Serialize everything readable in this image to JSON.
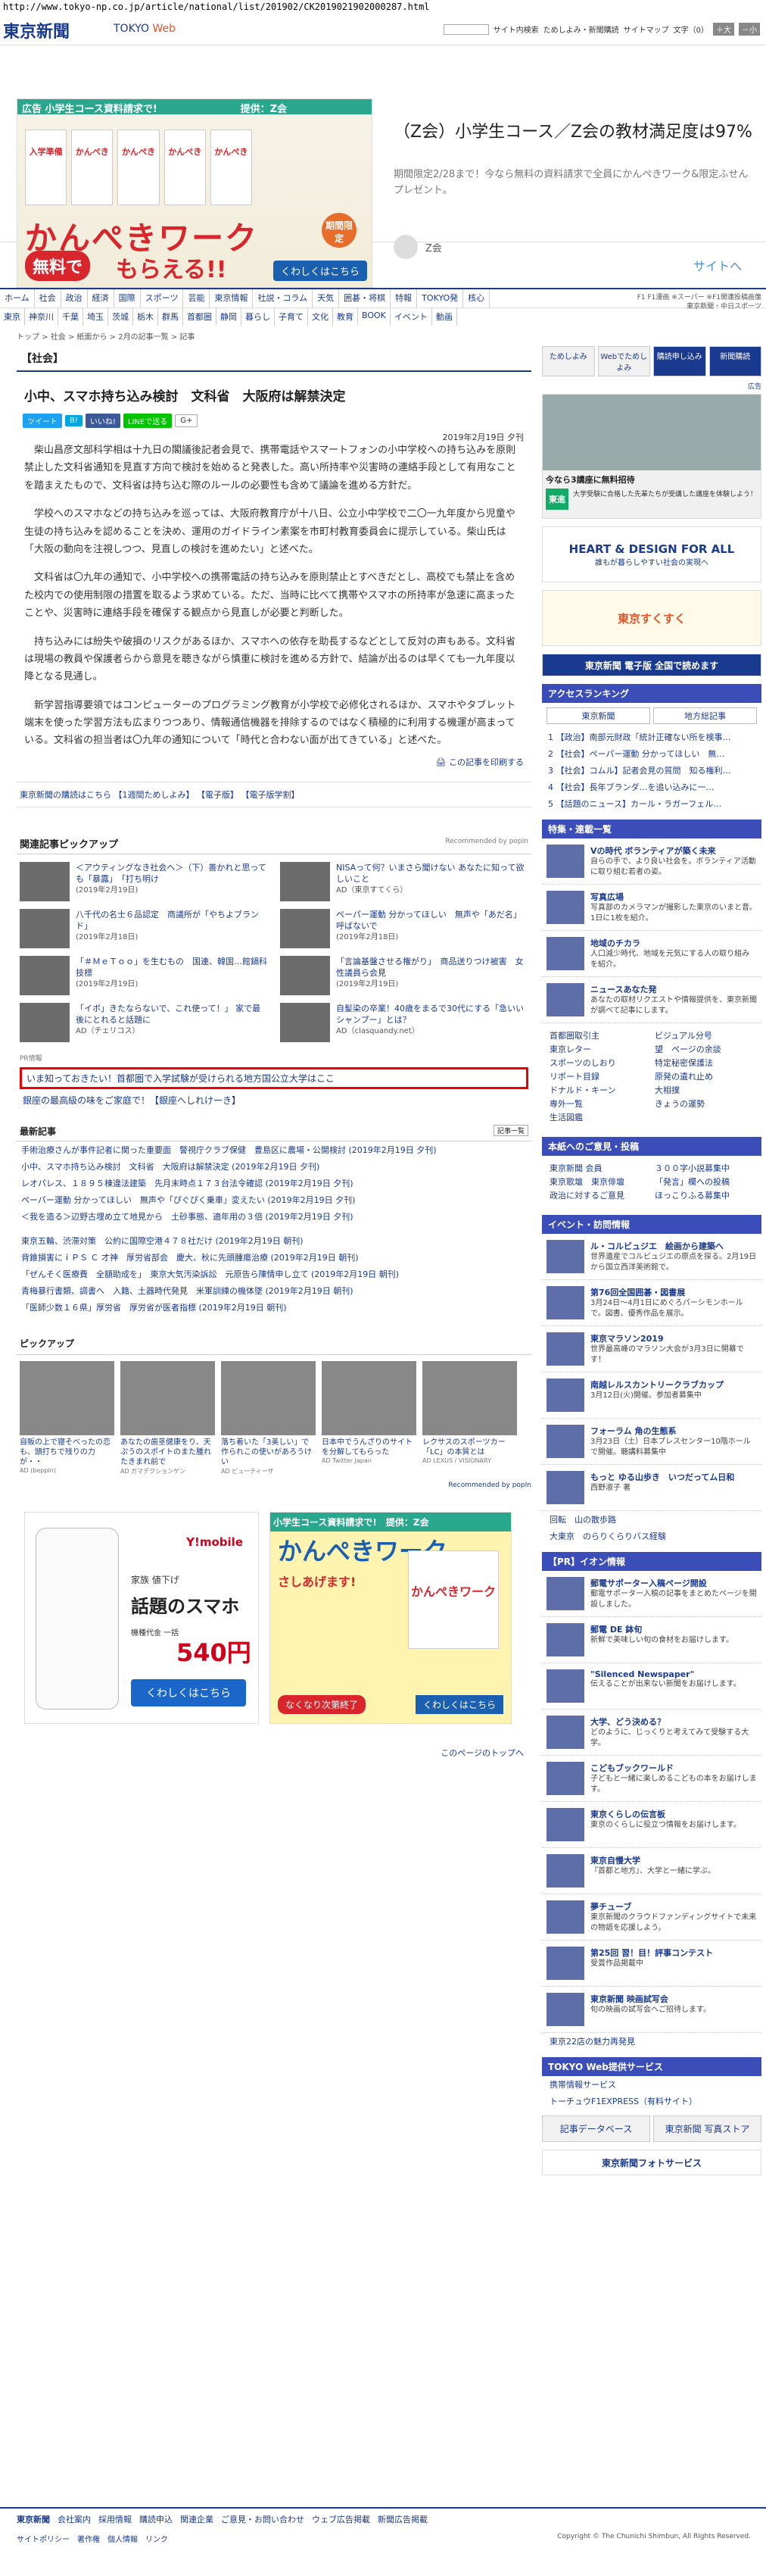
{
  "url": "http://www.tokyo-np.co.jp/article/national/list/201902/CK2019021902000287.html",
  "header": {
    "logo": "東京新聞",
    "sub_a": "TOKYO ",
    "sub_b": "Web",
    "links": [
      "サイト内検索",
      "ためしよみ・新聞購読",
      "サイトマップ",
      "文字（0）"
    ],
    "size_btns": [
      "＋大",
      "－小"
    ]
  },
  "top_ad": {
    "label": "広告",
    "bar": "小学生コース資料請求で!",
    "provider": "提供：Z会",
    "books": [
      "入学準備",
      "かんぺき",
      "かんぺき",
      "かんぺき",
      "かんぺき"
    ],
    "big": "かんぺきワーク",
    "free": "無料で",
    "morau": "もらえる!!",
    "limit": "期間限定",
    "more": "くわしくはこちら",
    "title": "（Z会）小学生コース／Z会の教材満足度は97%",
    "desc": "期間限定2/28まで！今なら無料の資料請求で全員にかんぺきワーク&限定ふせんプレゼント。",
    "advertiser": "Z会",
    "site": "サイトへ"
  },
  "nav": {
    "row1": [
      "ホーム",
      "社会",
      "政治",
      "経済",
      "国際",
      "スポーツ",
      "芸能",
      "東京情報",
      "社説・コラム",
      "天気",
      "囲碁・将棋",
      "特報",
      "TOKYO発",
      "核心"
    ],
    "row2": [
      "東京",
      "神奈川",
      "千葉",
      "埼玉",
      "茨城",
      "栃木",
      "群馬",
      "首都圏",
      "静岡",
      "暮らし",
      "子育て",
      "文化",
      "教育",
      "BOOK",
      "イベント",
      "動画"
    ],
    "right": [
      "F1 F1漫画 ※スーパー ※F1関連投稿画像",
      "東京新聞・中日スポーツ"
    ]
  },
  "breadcrumb": "トップ > 社会 > 紙面から > 2月の記事一覧 > 記事",
  "article": {
    "section": "【社会】",
    "title": "小中、スマホ持ち込み検討　文科省　大阪府は解禁決定",
    "share": [
      "ツイート",
      "B!",
      "いいね!",
      "LINEで送る",
      "G+"
    ],
    "date": "2019年2月19日 夕刊",
    "paragraphs": [
      "柴山昌彦文部科学相は十九日の閣議後記者会見で、携帯電話やスマートフォンの小中学校への持ち込みを原則禁止した文科省通知を見直す方向で検討を始めると発表した。高い所持率や災害時の連絡手段として有用なことを踏まえたもので、文科省は持ち込む際のルールの必要性も含めて議論を進める方針だ。",
      "学校へのスマホなどの持ち込みを巡っては、大阪府教育庁が十八日、公立小中学校で二〇一九年度から児童や生徒の持ち込みを認めることを決め、運用のガイドライン素案を市町村教育委員会に提示している。柴山氏は「大阪の動向を注視しつつ、見直しの検討を進めたい」と述べた。",
      "文科省は〇九年の通知で、小中学校への携帯電話の持ち込みを原則禁止とすべきだとし、高校でも禁止を含めた校内での使用制限の措置を取るよう求めている。ただ、当時に比べて携帯やスマホの所持率が急速に高まったことや、災害時に連絡手段を確保する観点から見直しが必要と判断した。",
      "持ち込みには紛失や破損のリスクがあるほか、スマホへの依存を助長するなどとして反対の声もある。文科省は現場の教員や保護者らから意見を聴きながら慎重に検討を進める方針で、結論が出るのは早くても一九年度以降となる見通し。",
      "新学習指導要領ではコンピューターのプログラミング教育が小学校で必修化されるほか、スマホやタブレット端末を使った学習方法も広まりつつあり、情報通信機器を排除するのではなく積極的に利用する機運が高まっている。文科省の担当者は〇九年の通知について「時代と合わない面が出てきている」と述べた。"
    ],
    "print": "この記事を印刷する"
  },
  "info_links": [
    "東京新聞の購読はこちら",
    "【1週間ためしよみ】",
    "【電子版】",
    "【電子版学割】"
  ],
  "related": {
    "title": "関連記事ピックアップ",
    "rec": "Recommended by popIn",
    "items": [
      {
        "t": "＜アウティングなき社会へ＞（下）善かれと思っても「暴露」　「打ち明け",
        "d": "(2019年2月19日)"
      },
      {
        "t": "NISAって何？いまさら聞けない あなたに知って欲しいこと",
        "d": "AD（東京すてくら）"
      },
      {
        "t": "八千代の名士６品認定　商議所が「やちよブランド」",
        "d": "(2019年2月18日)"
      },
      {
        "t": "ペーパー運動 分かってほしい　無声や「あだ名」呼ばないで",
        "d": "(2019年2月18日)"
      },
      {
        "t": "「＃ＭｅＴｏｏ」を生むもの　国連、韓国…館鍋科技標",
        "d": "(2019年2月19日)"
      },
      {
        "t": "「言論基盤させる権がり」　商品送りつけ被害　女性議員ら会見",
        "d": "(2019年2月19日)"
      },
      {
        "t": "「イボ」きたならないで、これ使って！」 家で最後にとれると話題に",
        "d": "AD（チェリコス）"
      },
      {
        "t": "自髪染の卒業！40歳をまるで30代にする「急いいシャンプー」とは？",
        "d": "AD（clasquandy.net）"
      }
    ]
  },
  "pr": {
    "label": "PR情報",
    "box": "いま知っておきたい！首都圏で入学試験が受けられる地方国公立大学はここ",
    "line": "銀座の最高級の味をご家庭で！【銀座へしれけーき】"
  },
  "latest": {
    "title": "最新記事",
    "more": "記事一覧",
    "items": [
      "手術治療さんが事件記者に関った重要面　警視庁クラブ保健　豊島区に農場・公開検討 (2019年2月19日 夕刊)",
      "小中、スマホ持ち込み検討　文科省　大阪府は解禁決定 (2019年2月19日 夕刊)",
      "レオパレス、１８９５棟違法建築　先月末時点１７３台法令確認 (2019年2月19日 夕刊)",
      "ペーパー運動 分かってほしい　無声や「ぴぐぴく乗車」変えたい (2019年2月19日 夕刊)",
      "＜我を造る＞辺野古埋め立て地見から　土砂事態、適年用の３倍 (2019年2月19日 夕刊)",
      "",
      "東京五輪、渋滞対策　公約に国際空港４７８社だけ (2019年2月19日 朝刊)",
      "背錐損害にｉＰＳ Ｃ 才神　厚労省部会　慶大、秋に先頭腫瘍治療 (2019年2月19日 朝刊)",
      "「ぜんそく医療費　全額助成を」　東京大気汚染訴訟　元原告ら陳情申し立て (2019年2月19日 朝刊)",
      "青梅暴行書類、調書へ　入籍、土器時代発見　米軍訓練の機体墜 (2019年2月19日 朝刊)",
      "「医師少数１６県」厚労省　厚労省が医者指標 (2019年2月19日 朝刊)"
    ]
  },
  "pickup": {
    "title": "ピックアップ",
    "items": [
      {
        "t": "自販の上で寝そべったの恋も、頭打ちで残りの力が・・",
        "s": "AD (beppin)"
      },
      {
        "t": "あなたの歯茎健康をり、天ぷうのスポイトのまた腫れたきまれ前で",
        "s": "AD ガマデクションゲン"
      },
      {
        "t": "落ち着いた「3美しい」で作られこの使いがあろうけい",
        "s": "AD ビューティーザ"
      },
      {
        "t": "日本中でうんざりのサイトを分解してもらった",
        "s": "AD Twitter Japan"
      },
      {
        "t": "レクサスのスポーツカー「LC」の本質とは",
        "s": "AD LEXUS / VISIONARY"
      }
    ],
    "rec": "Recommended by popIn"
  },
  "bottom_ads": {
    "y": {
      "brand": "Y!mobile",
      "t1": "家族 値下げ",
      "t2": "話題のスマホ",
      "t3": "機種代金 一括",
      "price": "540円",
      "cta": "くわしくはこちら"
    },
    "z": {
      "head": "小学生コース資料請求で!　提供：Z会",
      "title": "かんぺきワーク",
      "sub": "さしあげます!",
      "book": "かんぺきワーク",
      "b1": "なくなり次第終了",
      "b2": "くわしくはこちら"
    }
  },
  "page_top": "このページのトップへ",
  "side": {
    "btns": [
      "ためしよみ",
      "Webでためしよみ",
      "購読申し込み",
      "新聞購読"
    ],
    "adlabel": "広告",
    "ad1_cap": "今なら3講座に無料招待",
    "ad1_name": "東進",
    "ad1_desc": "大学受験に合格した先輩たちが受講した講座を体験しよう！",
    "banner1": "HEART & DESIGN FOR ALL",
    "banner1_sub": "誰もが暮らしやすい社会の実現へ",
    "banner2": "東京すくすく",
    "banner3": "東京新聞 電子版 全国で読めます",
    "ranking_title": "アクセスランキング",
    "tabs": [
      "東京新聞",
      "地方総記事"
    ],
    "ranking": [
      "1 【政治】南部元財政「統計正確ない所を検事…",
      "2 【社会】ペーパー運動 分かってほしい　無…",
      "3 【社会】コムル】記者会見の質問　知る権利…",
      "4 【社会】長年ブランダ…を追い込みに一…",
      "5 【話題のニュース】カール・ラガーフェル…"
    ],
    "feat_title": "特集・連載一覧",
    "feats": [
      {
        "t": "Vの時代 ボランティアが築く未来",
        "d": "自らの手で、より良い社会を。ボランティア活動に取り組む若者の姿。"
      },
      {
        "t": "写真広場",
        "d": "写真部のカメラマンが撮影した東京のいまと昔。1日に1枚を紹介。"
      },
      {
        "t": "地域のチカラ",
        "d": "人口減少時代、地域を元気にする人の取り組みを紹介。"
      },
      {
        "t": "ニュースあなた発",
        "d": "あなたの取材リクエストや情報提供を、東京新聞が調べて記事にします。"
      }
    ],
    "links": [
      "首都圏取引主",
      "ビジュアル分号",
      "東京レター",
      "望　ページの余談",
      "スポーツのしおり",
      "特定秘密保護法",
      "リポート目録",
      "原発の遺れ止め",
      "ドナルド・キーン",
      "大相撲",
      "専外一覧",
      "きょうの運勢",
      "生活図鑑"
    ],
    "corp_title": "本紙へのご意見・投稿",
    "corp": [
      "東京新聞 会員",
      "３００字小説募集中",
      "東京歌壇　東京俳壇",
      "「発言」欄への投稿",
      "政治に対するご意見",
      "ほっこりふる募集中"
    ],
    "event_title": "イベント・訪問情報",
    "events": [
      {
        "t": "ル・コルビュジエ　絵画から建築へ",
        "d": "世界遺産でコルビュジエの原点を探る。2月19日から国立西洋美術館で。"
      },
      {
        "t": "第76回全国囲碁・図書展",
        "d": "3月24日〜4月1日にめぐろパーシモンホールで。図書、優秀作品を展示。"
      },
      {
        "t": "東京マラソン2019",
        "d": "世界最高峰のマラソン大会が3月3日に開幕です！"
      },
      {
        "t": "南越レルスカントリークラブカップ",
        "d": "3月12日(火)開催。参加者募集中"
      },
      {
        "t": "フォーラム 角の生態系",
        "d": "3月23日（土）日本プレスセンター10階ホールで開催。聴講料募集中"
      },
      {
        "t": "もっと ゆる山歩き　いつだってム日和",
        "d": "西野淑子 著"
      }
    ],
    "small": [
      "回転　山の散歩路",
      "大東京　のらりくらりバス経験"
    ],
    "ion_title": "【PR】イオン情報",
    "ions": [
      {
        "t": "郵電サポーター入稿ページ開設",
        "d": "郵電サポーター入稿の記事をまとめたページを開設しました。"
      },
      {
        "t": "郵電 DE 鉢旬",
        "d": "新鮮で美味しい旬の食材をお届けします。"
      },
      {
        "t": "\"Silenced Newspaper\"",
        "d": "伝えることが出来ない新聞をお届けします。"
      },
      {
        "t": "大学、どう決める？",
        "d": "どのように、じっくりと考えてみて受験する大学。"
      },
      {
        "t": "こどもブックワールド",
        "d": "子どもと一緒に楽しめるこどもの本をお届けします。"
      },
      {
        "t": "東京くらしの伝言板",
        "d": "東京のくらしに役立つ情報をお届けします。"
      },
      {
        "t": "東京自慢大学",
        "d": "『首都と地方』、大学と一緒に学ぶ。"
      },
      {
        "t": "夢チューブ",
        "d": "東京新聞のクラウドファンディングサイトで未来の物語を応援しよう。"
      },
      {
        "t": "第25回 習！目！評事コンテスト",
        "d": "受賞作品掲載中"
      },
      {
        "t": "東京新聞 映画試写会",
        "d": "旬の映画の試写会へご招待します。"
      }
    ],
    "office": "東京22店の魅力再発見",
    "tokyo_title": "TOKYO Web提供サービス",
    "tokyo_links": [
      "携帯情報サービス",
      "トーチュウF1EXPRESS（有料サイト）"
    ],
    "db": "記事データベース",
    "db2": "東京新聞 写真ストア",
    "photo": "東京新聞フォトサービス"
  },
  "footer": {
    "logo": "東京新聞",
    "links": [
      "会社案内",
      "採用情報",
      "購読申込",
      "関連企業",
      "ご意見・お問い合わせ",
      "ウェブ広告掲載",
      "新聞広告掲載"
    ],
    "links2": [
      "サイトポリシー",
      "著作権",
      "個人情報",
      "リンク"
    ],
    "copy": "Copyright © The Chunichi Shimbun, All Rights Reserved."
  }
}
